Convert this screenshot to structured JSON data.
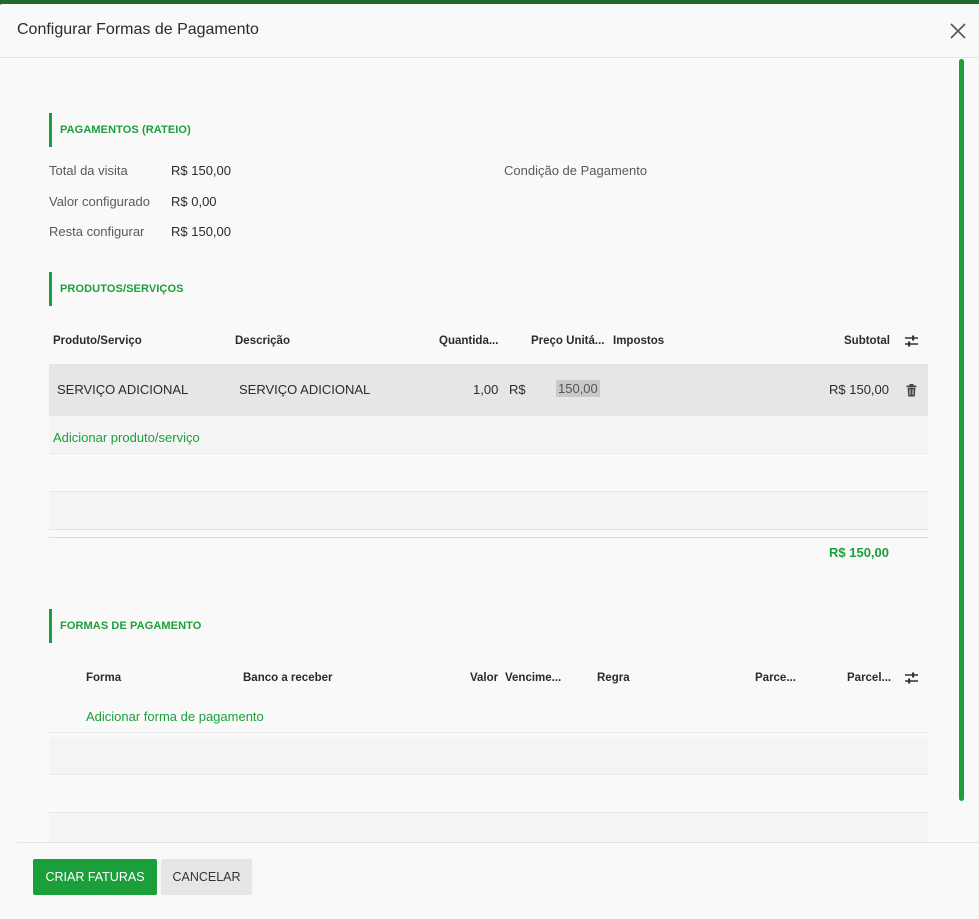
{
  "modal": {
    "title": "Configurar Formas de Pagamento"
  },
  "pagamentos": {
    "section_title": "PAGAMENTOS (RATEIO)",
    "total_label": "Total da visita",
    "total_value": "R$ 150,00",
    "configurado_label": "Valor configurado",
    "configurado_value": "R$ 0,00",
    "resta_label": "Resta configurar",
    "resta_value": "R$ 150,00",
    "condicao_label": "Condição de Pagamento"
  },
  "produtos": {
    "section_title": "PRODUTOS/SERVIÇOS",
    "columns": [
      "Produto/Serviço",
      "Descrição",
      "Quantida...",
      "Preço Unitá...",
      "Impostos",
      "Subtotal"
    ],
    "rows": [
      {
        "produto": "SERVIÇO ADICIONAL",
        "descricao": "SERVIÇO ADICIONAL",
        "quantidade": "1,00",
        "currency": "R$",
        "preco": "150,00",
        "subtotal": "R$ 150,00"
      }
    ],
    "add_link": "Adicionar produto/serviço",
    "total": "R$ 150,00"
  },
  "formas": {
    "section_title": "FORMAS DE PAGAMENTO",
    "columns": [
      "Forma",
      "Banco a receber",
      "Valor",
      "Vencime...",
      "Regra",
      "Parce...",
      "Parcel..."
    ],
    "add_link": "Adicionar forma de pagamento"
  },
  "footer": {
    "primary_label": "CRIAR FATURAS",
    "secondary_label": "CANCELAR"
  },
  "colors": {
    "accent": "#1a9f3b",
    "topbar": "#1f6b2c"
  },
  "icons": [
    "close-icon",
    "column-settings-icon",
    "trash-icon"
  ]
}
